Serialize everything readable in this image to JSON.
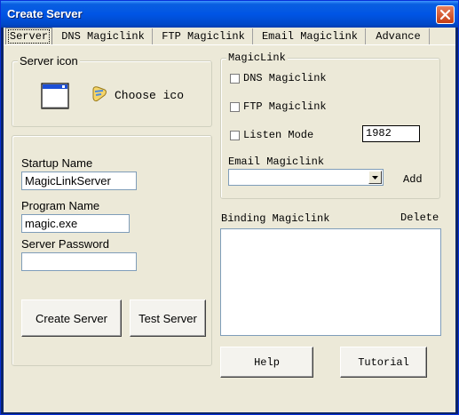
{
  "window": {
    "title": "Create Server"
  },
  "tabs": [
    {
      "label": "Server",
      "selected": true
    },
    {
      "label": "DNS Magiclink",
      "selected": false
    },
    {
      "label": "FTP Magiclink",
      "selected": false
    },
    {
      "label": "Email Magiclink",
      "selected": false
    },
    {
      "label": "Advance",
      "selected": false
    }
  ],
  "server_icon": {
    "group_label": "Server icon",
    "choose_label": "Choose ico"
  },
  "startup": {
    "startup_name_label": "Startup Name",
    "startup_name_value": "MagicLinkServer",
    "program_name_label": "Program Name",
    "program_name_value": "magic.exe",
    "password_label": "Server Password",
    "password_value": ""
  },
  "buttons": {
    "create_server": "Create Server",
    "test_server": "Test Server",
    "help": "Help",
    "tutorial": "Tutorial",
    "add": "Add",
    "delete": "Delete"
  },
  "magiclink": {
    "group_label": "MagicLink",
    "dns_label": "DNS Magiclink",
    "ftp_label": "FTP Magiclink",
    "listen_label": "Listen Mode",
    "listen_port": "1982",
    "email_label": "Email Magiclink",
    "email_selected": ""
  },
  "binding": {
    "label": "Binding Magiclink"
  },
  "colors": {
    "titlebar": "#0055e5",
    "client_bg": "#ece9d8",
    "close_button": "#c43d14"
  }
}
